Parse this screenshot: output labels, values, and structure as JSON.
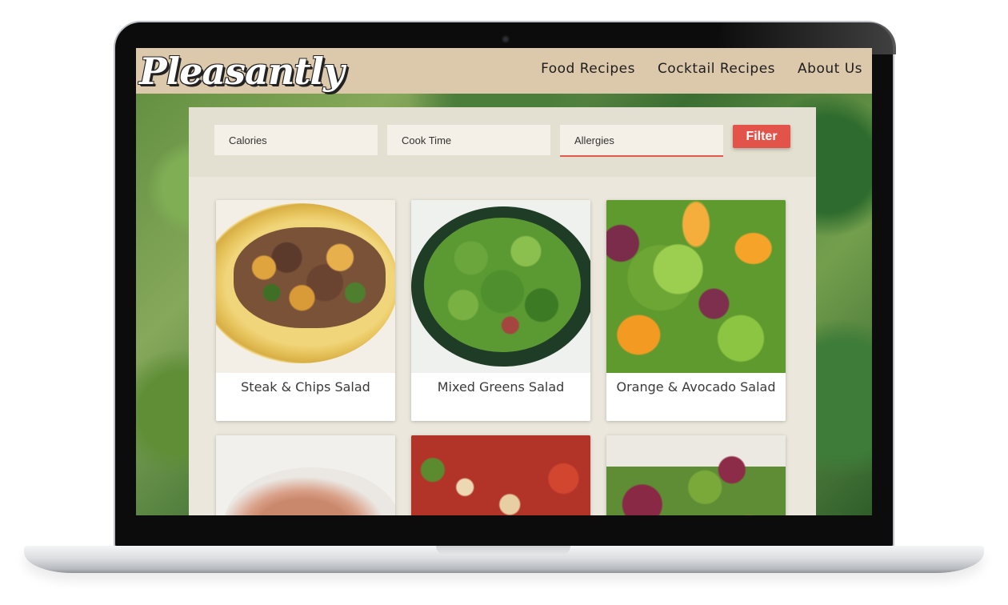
{
  "header": {
    "logo": "Pleasantly",
    "nav": [
      "Food Recipes",
      "Cocktail Recipes",
      "About Us"
    ]
  },
  "filters": {
    "calories_placeholder": "Calories",
    "cook_time_placeholder": "Cook Time",
    "allergies_placeholder": "Allergies",
    "button_label": "Filter",
    "accent_color": "#e2534a"
  },
  "recipes": [
    {
      "title": "Steak & Chips Salad",
      "image": "steak-salad-photo"
    },
    {
      "title": "Mixed Greens Salad",
      "image": "mixed-greens-photo"
    },
    {
      "title": "Orange & Avocado Salad",
      "image": "orange-avocado-photo"
    },
    {
      "title": "",
      "image": "shrimp-dish-photo"
    },
    {
      "title": "",
      "image": "strawberry-nut-salad-photo"
    },
    {
      "title": "",
      "image": "leafy-salad-photo"
    }
  ]
}
